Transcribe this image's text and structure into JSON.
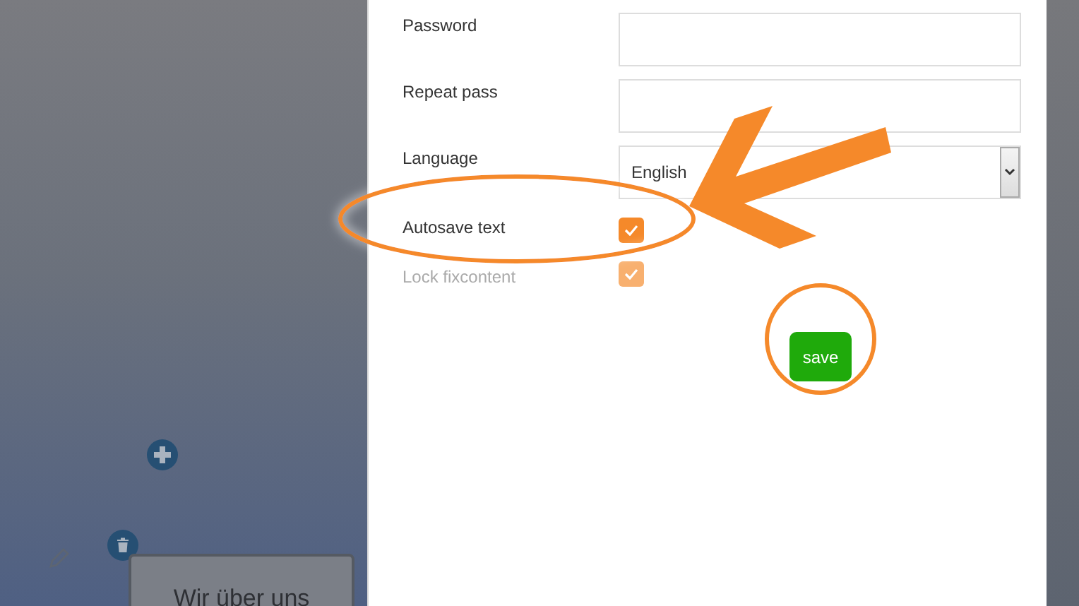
{
  "canvas": {
    "card": {
      "title": "Wir über uns"
    }
  },
  "form": {
    "fields": [
      {
        "kind": "password",
        "label": "Password"
      },
      {
        "kind": "password",
        "label": "Repeat pass"
      },
      {
        "kind": "select",
        "label": "Language",
        "value": "English"
      },
      {
        "kind": "checkbox",
        "label": "Autosave text",
        "checked": true,
        "disabled": false
      },
      {
        "kind": "checkbox",
        "label": "Lock fixcontent",
        "checked": true,
        "disabled": true
      }
    ],
    "save_button": {
      "label": "save"
    }
  }
}
